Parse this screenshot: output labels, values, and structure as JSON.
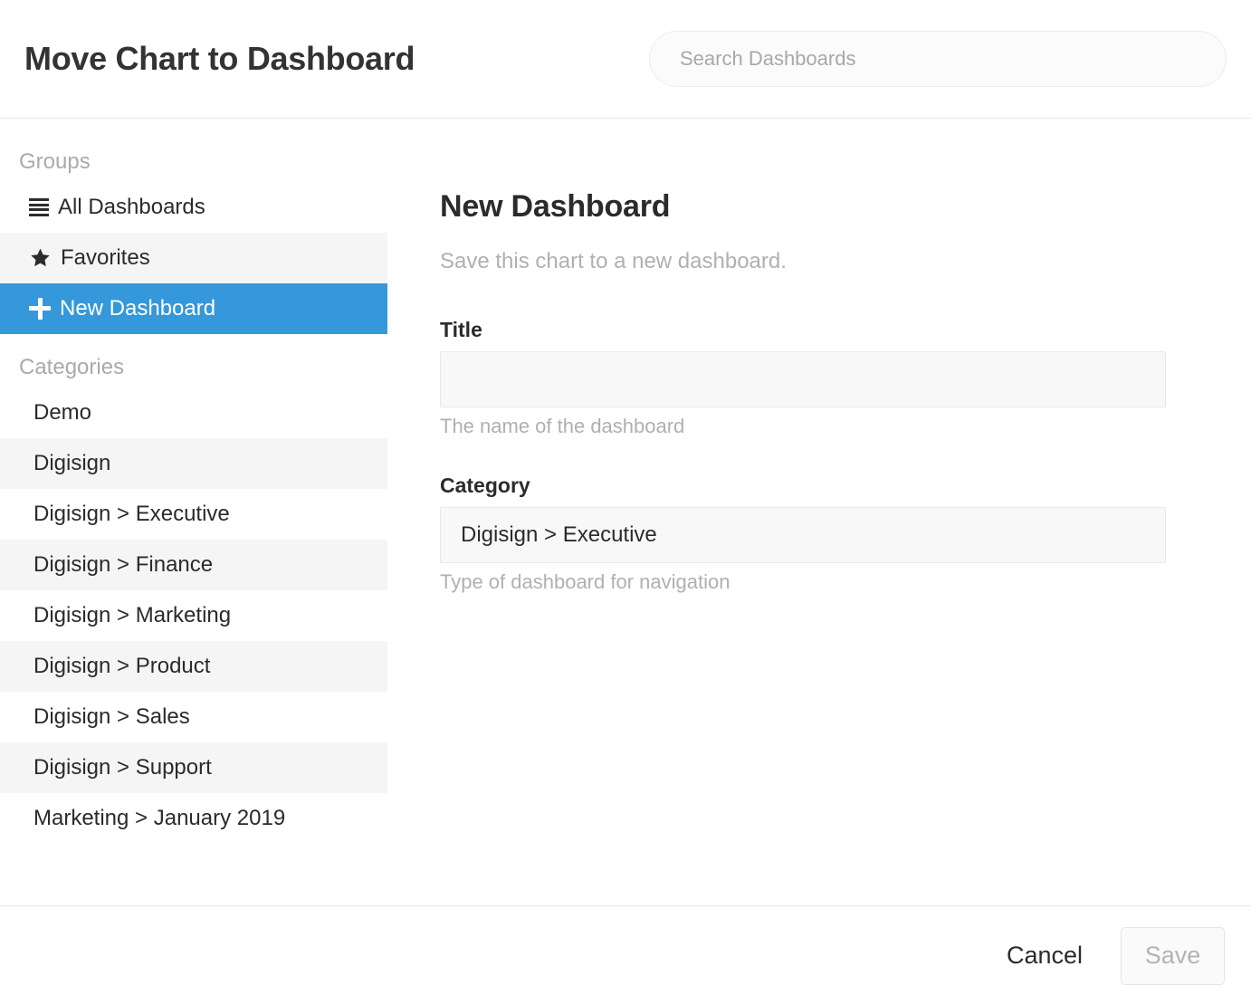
{
  "header": {
    "title": "Move Chart to Dashboard",
    "search": {
      "placeholder": "Search Dashboards",
      "value": ""
    }
  },
  "sidebar": {
    "groups_label": "Groups",
    "groups": [
      {
        "label": "All Dashboards",
        "icon": "hamburger-icon",
        "state": "default"
      },
      {
        "label": "Favorites",
        "icon": "star-icon",
        "state": "alt"
      },
      {
        "label": "New Dashboard",
        "icon": "plus-icon",
        "state": "active"
      }
    ],
    "categories_label": "Categories",
    "categories": [
      {
        "label": "Demo"
      },
      {
        "label": "Digisign"
      },
      {
        "label": "Digisign > Executive"
      },
      {
        "label": "Digisign > Finance"
      },
      {
        "label": "Digisign > Marketing"
      },
      {
        "label": "Digisign > Product"
      },
      {
        "label": "Digisign > Sales"
      },
      {
        "label": "Digisign > Support"
      },
      {
        "label": "Marketing > January 2019"
      }
    ]
  },
  "main": {
    "title": "New Dashboard",
    "subtitle": "Save this chart to a new dashboard.",
    "fields": [
      {
        "label": "Title",
        "value": "",
        "placeholder": "",
        "help": "The name of the dashboard"
      },
      {
        "label": "Category",
        "value": "Digisign > Executive",
        "placeholder": "",
        "help": "Type of dashboard for navigation"
      }
    ]
  },
  "footer": {
    "cancel_label": "Cancel",
    "save_label": "Save",
    "save_enabled": false
  },
  "colors": {
    "accent": "#3498db",
    "row_stripe": "#f5f5f5",
    "muted_text": "#b0b0b0",
    "body_text": "#2b2b2b",
    "divider": "#e7e7e7"
  }
}
